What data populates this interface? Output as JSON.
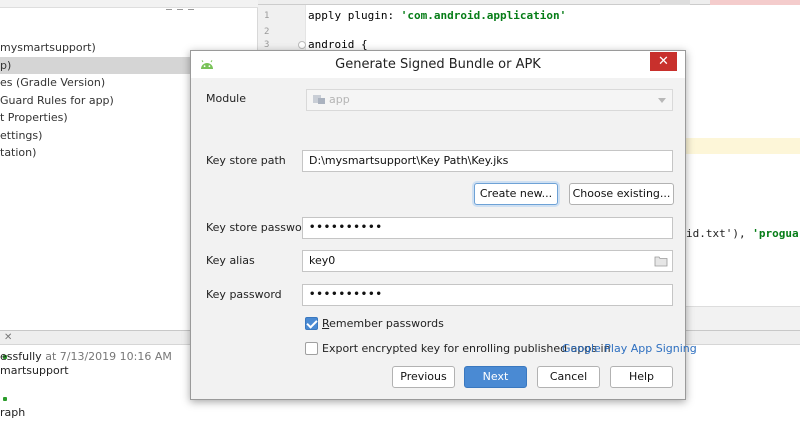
{
  "project_tree": {
    "items": [
      {
        "text": "mysmartsupport)",
        "selected": false
      },
      {
        "text": "p)",
        "selected": true
      },
      {
        "text": "es (Gradle Version)",
        "selected": false
      },
      {
        "text": "Guard Rules for app)",
        "selected": false
      },
      {
        "text": "t Properties)",
        "selected": false
      },
      {
        "text": "ettings)",
        "selected": false
      },
      {
        "text": "tation)",
        "selected": false
      }
    ]
  },
  "editor": {
    "lines": [
      {
        "num": "1",
        "pre": "apply plugin: ",
        "str": "'com.android.application'",
        "post": ""
      },
      {
        "num": "2",
        "pre": "",
        "str": "",
        "post": ""
      },
      {
        "num": "3",
        "pre": "android {",
        "str": "",
        "post": ""
      }
    ],
    "partial_line": {
      "pre": "id.txt'), ",
      "str": "'proguar"
    }
  },
  "build": {
    "status_text": "essfully",
    "status_time": " at 7/13/2019 10:16 AM",
    "project_name": "martsupport",
    "graph_label": "raph"
  },
  "dialog": {
    "title": "Generate Signed Bundle or APK",
    "close_label": "✕",
    "module": {
      "label": "Module",
      "value": "app"
    },
    "key_store_path": {
      "label": "Key store path",
      "value": "D:\\mysmartsupport\\Key Path\\Key.jks"
    },
    "create_new_label": "Create new...",
    "choose_existing_label": "Choose existing...",
    "key_store_password": {
      "label": "Key store password",
      "value": "••••••••••"
    },
    "key_alias": {
      "label": "Key alias",
      "value": "key0"
    },
    "key_password": {
      "label": "Key password",
      "value": "••••••••••"
    },
    "remember_passwords": {
      "label_pre": "",
      "label_ul": "R",
      "label_post": "emember passwords",
      "checked": true
    },
    "export_encrypted": {
      "label": "Export encrypted key for enrolling published apps in",
      "checked": false
    },
    "export_link": "Google Play App Signing",
    "previous_label": "Previous",
    "next_label": "Next",
    "cancel_label": "Cancel",
    "help_label": "Help"
  },
  "colors": {
    "primary_button": "#4a8ad3",
    "close_button": "#c8302c",
    "link": "#2d6fc0",
    "android_green": "#78c257"
  }
}
